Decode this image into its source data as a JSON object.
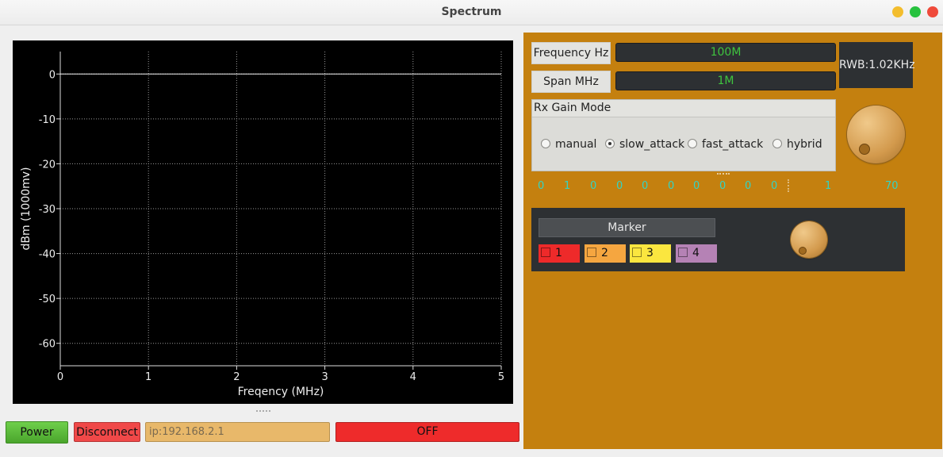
{
  "window": {
    "title": "Spectrum"
  },
  "colors": {
    "panel_bg": "#c4800f",
    "lcd_text": "#3fc43f",
    "digit_text": "#32d4c4",
    "off_red": "#ee2b2b",
    "power_green": "#5bbd3a"
  },
  "chart_data": {
    "type": "line",
    "xlabel": "Freqency (MHz)",
    "ylabel": "dBm (1000mv)",
    "xlim": [
      0,
      5
    ],
    "ylim": [
      -65,
      5
    ],
    "xticks": [
      "0",
      "1",
      "2",
      "3",
      "4",
      "5"
    ],
    "yticks": [
      "0",
      "-10",
      "-20",
      "-30",
      "-40",
      "-50",
      "-60"
    ],
    "grid": true,
    "series": [
      {
        "x": [
          0,
          5
        ],
        "y": [
          0,
          0
        ]
      }
    ]
  },
  "controls": {
    "power_label": "Power",
    "disconnect_label": "Disconnect",
    "ip_placeholder": "ip:192.168.2.1",
    "status": "OFF"
  },
  "frequency": {
    "label": "Frequency Hz",
    "value": "100M"
  },
  "span": {
    "label": "Span MHz",
    "value": "1M"
  },
  "rwb": "RWB:1.02KHz",
  "gain_mode": {
    "title": "Rx Gain Mode",
    "options": [
      "manual",
      "slow_attack",
      "fast_attack",
      "hybrid"
    ],
    "selected": "slow_attack"
  },
  "gain_digits": [
    "0",
    "1",
    "0",
    "0",
    "0",
    "0",
    "0",
    "0",
    "0",
    "0"
  ],
  "gain_scale": [
    "1",
    "70"
  ],
  "marker": {
    "label": "Marker",
    "items": [
      {
        "label": "1",
        "color": "#ee2a2a"
      },
      {
        "label": "2",
        "color": "#f5a640"
      },
      {
        "label": "3",
        "color": "#fbe63f"
      },
      {
        "label": "4",
        "color": "#b582b5"
      }
    ]
  }
}
